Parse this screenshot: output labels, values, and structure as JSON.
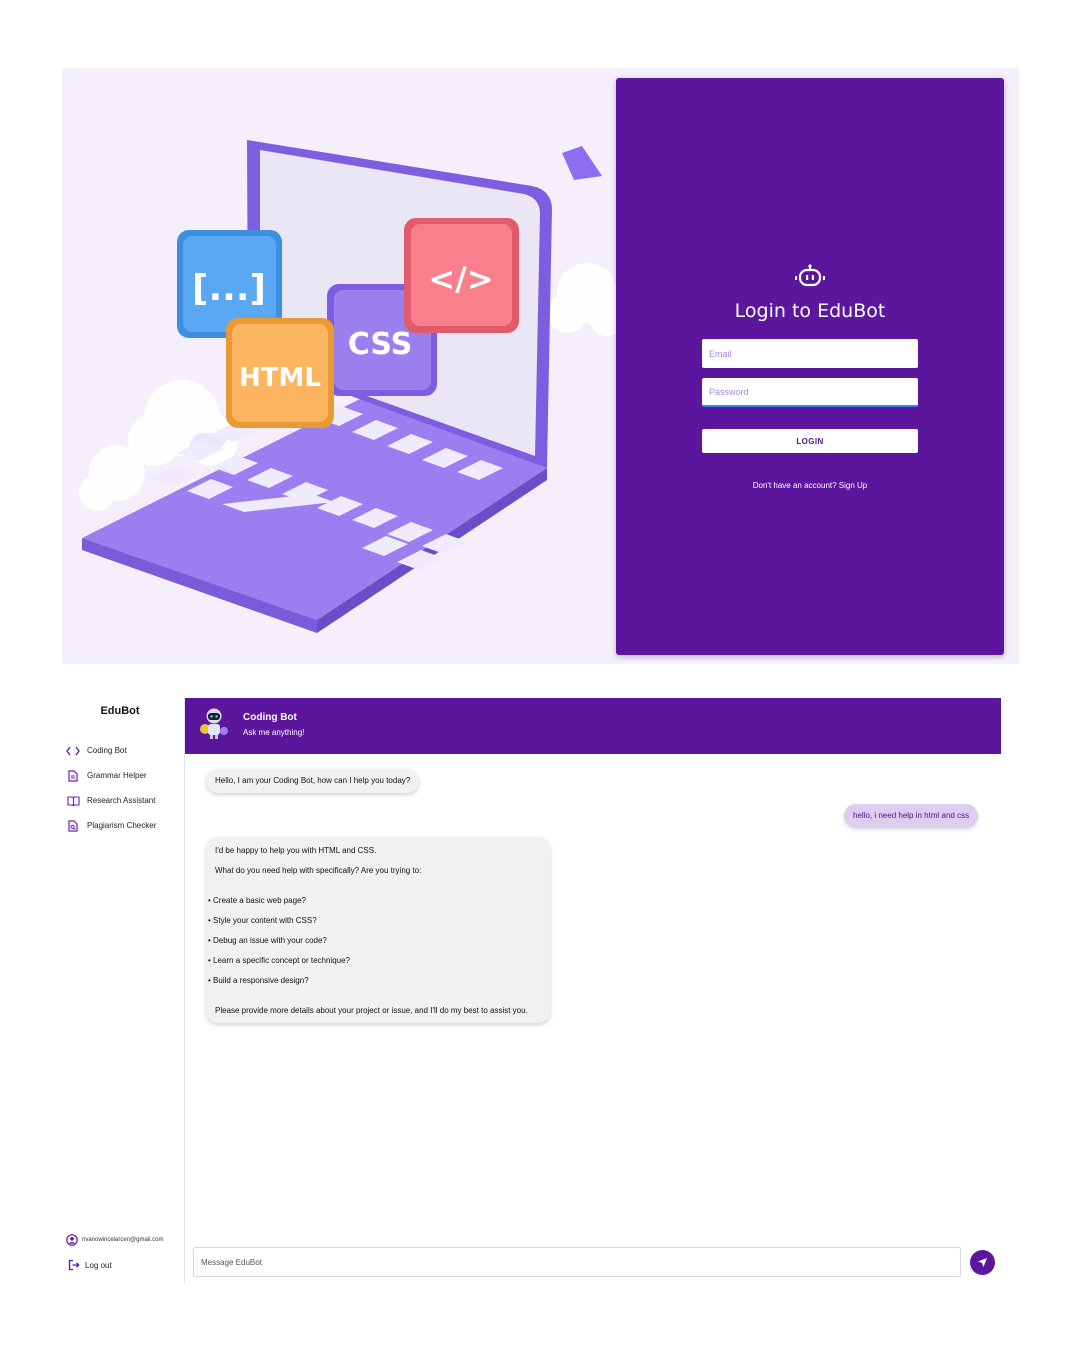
{
  "login": {
    "title": "Login to EduBot",
    "email_placeholder": "Email",
    "password_placeholder": "Password",
    "login_button": "LOGIN",
    "signup_text": "Don't have an account? Sign Up",
    "illustration_labels": {
      "brackets": "[...]",
      "html": "HTML",
      "css": "CSS",
      "code": "</>"
    }
  },
  "sidebar": {
    "brand": "EduBot",
    "items": [
      {
        "label": "Coding Bot",
        "icon": "code-icon"
      },
      {
        "label": "Grammar Helper",
        "icon": "document-icon"
      },
      {
        "label": "Research Assistant",
        "icon": "book-icon"
      },
      {
        "label": "Plagiarism Checker",
        "icon": "search-document-icon"
      }
    ],
    "account_email": "rivanowincelarcen@gmail.com",
    "logout": "Log out"
  },
  "chat": {
    "bot_name": "Coding Bot",
    "bot_subtitle": "Ask me anything!",
    "messages": {
      "greeting": "Hello, I am your Coding Bot, how can I help you today?",
      "user": "hello, i need help in html and css",
      "reply": {
        "intro": "I'd be happy to help you with HTML and CSS.",
        "question": "What do you need help with specifically? Are you trying to:",
        "options": [
          "Create a basic web page?",
          "Style your content with CSS?",
          "Debug an issue with your code?",
          "Learn a specific concept or technique?",
          "Build a responsive design?"
        ],
        "closing": "Please provide more details about your project or issue, and I'll do my best to assist you."
      }
    },
    "input_placeholder": "Message EduBot"
  },
  "colors": {
    "brand_purple": "#5c169e",
    "user_bubble": "#dccdf1",
    "bot_bubble": "#f1f1f1",
    "hero_bg": "#f4effb"
  }
}
